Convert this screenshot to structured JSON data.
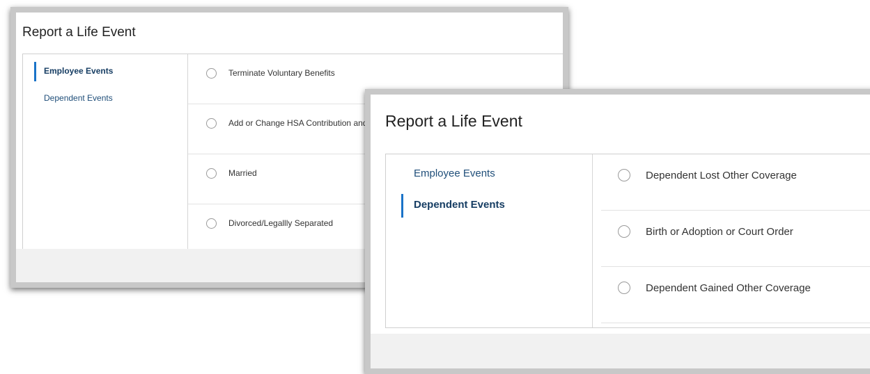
{
  "back_dialog": {
    "title": "Report a Life Event",
    "nav": [
      {
        "label": "Employee Events",
        "active": true
      },
      {
        "label": "Dependent Events",
        "active": false
      }
    ],
    "options": [
      "Terminate Voluntary Benefits",
      "Add or Change HSA Contribution and",
      "Married",
      "Divorced/Legallly Separated"
    ]
  },
  "front_dialog": {
    "title": "Report a Life Event",
    "nav": [
      {
        "label": "Employee Events",
        "active": false
      },
      {
        "label": "Dependent Events",
        "active": true
      }
    ],
    "options": [
      "Dependent Lost Other Coverage",
      "Birth or Adoption or Court Order",
      "Dependent Gained Other Coverage"
    ]
  },
  "colors": {
    "accent_bar": "#1a73c8",
    "nav_text": "#1f4e79",
    "frame_border": "#c8c8c8"
  }
}
